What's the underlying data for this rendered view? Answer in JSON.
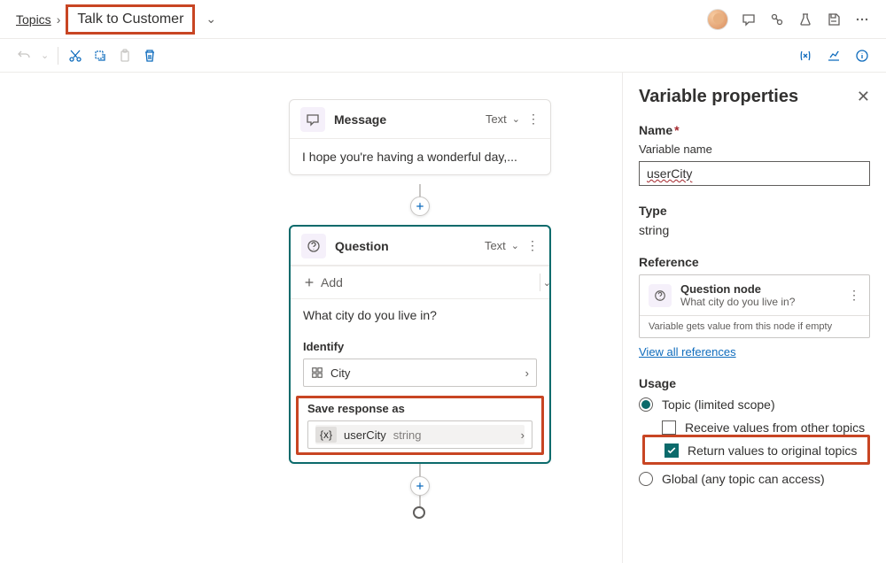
{
  "breadcrumb": {
    "root": "Topics",
    "current": "Talk to Customer"
  },
  "canvas": {
    "message_node": {
      "title": "Message",
      "meta": "Text",
      "body": "I hope you're having a wonderful day,..."
    },
    "question_node": {
      "title": "Question",
      "meta": "Text",
      "add": "Add",
      "prompt": "What city do you live in?",
      "identify_label": "Identify",
      "identify_value": "City",
      "save_label": "Save response as",
      "var_name": "userCity",
      "var_type": "string"
    }
  },
  "panel": {
    "title": "Variable properties",
    "name_label": "Name",
    "name_sublabel": "Variable name",
    "name_value": "userCity",
    "type_label": "Type",
    "type_value": "string",
    "ref_label": "Reference",
    "ref_node_title": "Question node",
    "ref_node_sub": "What city do you live in?",
    "ref_note": "Variable gets value from this node if empty",
    "view_all": "View all references",
    "usage_label": "Usage",
    "usage_topic": "Topic (limited scope)",
    "usage_receive": "Receive values from other topics",
    "usage_return": "Return values to original topics",
    "usage_global": "Global (any topic can access)"
  }
}
